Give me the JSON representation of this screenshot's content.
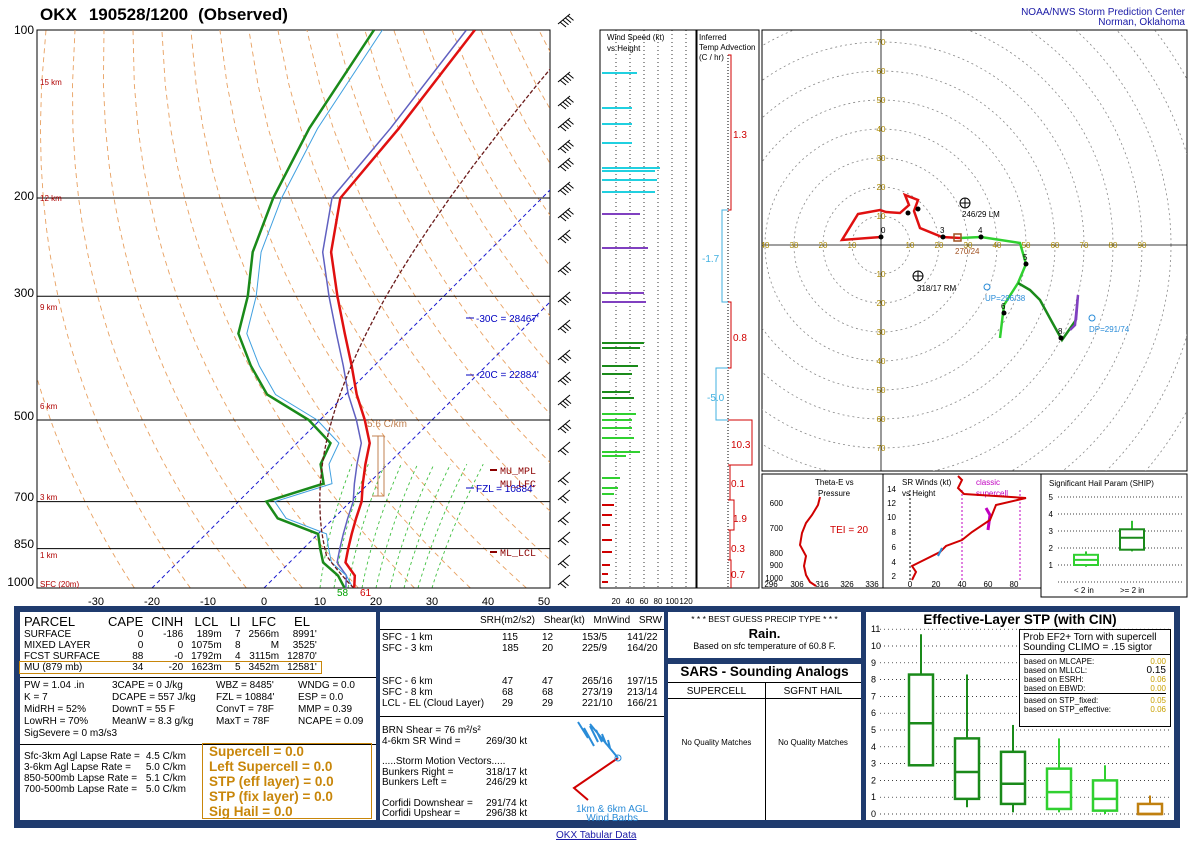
{
  "header": {
    "station": "OKX",
    "time": "190528/1200",
    "status": "(Observed)",
    "org_line1": "NOAA/NWS Storm Prediction Center",
    "org_line2": "Norman, Oklahoma"
  },
  "skewt": {
    "pressure_labels": [
      "100",
      "200",
      "300",
      "500",
      "700",
      "850",
      "1000"
    ],
    "temp_ticks": [
      "-30",
      "-20",
      "-10",
      "0",
      "10",
      "20",
      "30",
      "40",
      "50"
    ],
    "height_labels": [
      "15 km",
      "12 km",
      "9 km",
      "6 km",
      "3 km",
      "1 km",
      "SFC (20m)"
    ],
    "isotherm_labels": [
      "-30C = 28467'",
      "-20C = 22884'"
    ],
    "fzl_label": "FZL = 10884'",
    "lapse_label": "5.6 C/km",
    "mu_mpl": "MU_MPL",
    "mu_lfc": "MU_LFC",
    "ml_lcl": "ML_LCL",
    "sfc_td": "58",
    "sfc_t": "61"
  },
  "wind_speed": {
    "title1": "Wind Speed (kt)",
    "title2": "vs Height",
    "axis": [
      "20",
      "40",
      "60",
      "80",
      "100",
      "120"
    ]
  },
  "temp_adv": {
    "title1": "Inferred",
    "title2": "Temp Advection",
    "title3": "(C / hr)",
    "values": [
      "1.3",
      "-1.7",
      "0.8",
      "-5.0",
      "10.3",
      "0.1",
      "1.9",
      "0.3",
      "0.7"
    ]
  },
  "hodograph": {
    "rings": [
      "10",
      "20",
      "30",
      "40",
      "50",
      "60",
      "70"
    ],
    "lm": "246/29 LM",
    "rm": "318/17 RM",
    "mean": "270/24",
    "up": "UP=296/38",
    "dp": "DP=291/74",
    "points": [
      "0",
      "3",
      "4",
      "5",
      "6",
      "8"
    ]
  },
  "insets": {
    "theta_title1": "Theta-E vs",
    "theta_title2": "Pressure",
    "theta_axis": [
      "296",
      "306",
      "316",
      "326",
      "336"
    ],
    "theta_p": [
      "600",
      "700",
      "800",
      "900",
      "1000"
    ],
    "tei": "TEI = 20",
    "sr_title1": "SR Winds (kt)",
    "sr_title2": "vs Height",
    "sr_classic1": "classic",
    "sr_classic2": "supercell",
    "sr_heights": [
      "14",
      "12",
      "10",
      "8",
      "6",
      "4",
      "2",
      "0"
    ],
    "sr_axis": [
      "0",
      "20",
      "40",
      "60",
      "80"
    ],
    "ship_title": "Significant Hail Param (SHIP)",
    "ship_y": [
      "5",
      "4",
      "3",
      "2",
      "1"
    ],
    "ship_x1": "< 2 in",
    "ship_x2": ">= 2 in"
  },
  "parcel": {
    "headers": [
      "PARCEL",
      "CAPE",
      "CINH",
      "LCL",
      "LI",
      "LFC",
      "EL"
    ],
    "rows": [
      [
        "SURFACE",
        "0",
        "-186",
        "189m",
        "7",
        "2566m",
        "8991'"
      ],
      [
        "MIXED LAYER",
        "0",
        "0",
        "1075m",
        "8",
        "M",
        "3525'"
      ],
      [
        "FCST SURFACE",
        "88",
        "-0",
        "1792m",
        "4",
        "3115m",
        "12870'"
      ],
      [
        "MU  (879 mb)",
        "34",
        "-20",
        "1623m",
        "5",
        "3452m",
        "12581'"
      ]
    ],
    "misc_left": [
      "PW = 1.04 .in",
      "K = 7",
      "MidRH = 52%",
      "LowRH = 70%",
      "SigSevere = 0 m3/s3"
    ],
    "misc_mid1": [
      "3CAPE = 0 J/kg",
      "DCAPE = 557 J/kg",
      "DownT = 55 F",
      "MeanW = 8.3 g/kg"
    ],
    "misc_mid2": [
      "WBZ = 8485'",
      "FZL = 10884'",
      "ConvT = 78F",
      "MaxT = 78F"
    ],
    "misc_right": [
      "WNDG = 0.0",
      "ESP = 0.0",
      "MMP = 0.39",
      "NCAPE = 0.09"
    ],
    "lapse": [
      [
        "Sfc-3km Agl Lapse Rate =",
        "4.5 C/km"
      ],
      [
        "3-6km Agl Lapse Rate =",
        "5.0 C/km"
      ],
      [
        "850-500mb Lapse Rate =",
        "5.1 C/km"
      ],
      [
        "700-500mb Lapse Rate =",
        "5.0 C/km"
      ]
    ],
    "indices": [
      "Supercell = 0.0",
      "Left Supercell = 0.0",
      "STP (eff layer) = 0.0",
      "STP (fix layer) = 0.0",
      "Sig Hail = 0.0"
    ]
  },
  "kinematics": {
    "headers": [
      "SRH(m2/s2)",
      "Shear(kt)",
      "MnWind",
      "SRW"
    ],
    "rows": [
      [
        "SFC - 1 km",
        "115",
        "12",
        "153/5",
        "141/22"
      ],
      [
        "SFC - 3 km",
        "185",
        "20",
        "225/9",
        "164/20"
      ],
      [
        "",
        "",
        " ",
        "",
        ""
      ],
      [
        "SFC - 6 km",
        "47",
        "",
        "265/16",
        "197/15"
      ],
      [
        "SFC - 8 km",
        "68",
        "",
        "273/19",
        "213/14"
      ],
      [
        "LCL - EL (Cloud Layer)",
        "29",
        "",
        "221/10",
        "166/21"
      ]
    ],
    "shear_col": [
      "12",
      "20",
      "",
      "47",
      "68",
      "29"
    ],
    "brn": "BRN Shear = 76 m²/s²",
    "sr46": [
      "4-6km SR Wind =",
      "269/30 kt"
    ],
    "storm_title": ".....Storm Motion Vectors.....",
    "motions": [
      [
        "Bunkers Right =",
        "318/17 kt"
      ],
      [
        "Bunkers Left =",
        "246/29 kt"
      ],
      [
        "",
        ""
      ],
      [
        "Corfidi Downshear =",
        "291/74 kt"
      ],
      [
        "Corfidi Upshear =",
        "296/38 kt"
      ]
    ],
    "barb_label1": "1km & 6km AGL",
    "barb_label2": "Wind Barbs"
  },
  "precip": {
    "title": "* * * BEST GUESS PRECIP TYPE * * *",
    "value": "Rain.",
    "note": "Based on sfc temperature of 60.8 F."
  },
  "sars": {
    "title": "SARS - Sounding Analogs",
    "col1": "SUPERCELL",
    "col2": "SGFNT HAIL",
    "match1": "No Quality Matches",
    "match2": "No Quality Matches"
  },
  "stp": {
    "title": "Effective-Layer STP (with CIN)",
    "y_ticks": [
      "11",
      "10",
      "9",
      "8",
      "7",
      "6",
      "5",
      "4",
      "3",
      "2",
      "1",
      "0"
    ],
    "categories": [
      "EF4+",
      "EF3",
      "EF2",
      "EF1",
      "EF0",
      "NONTOR"
    ],
    "prob_title1": "Prob EF2+ Torn with supercell",
    "prob_title2": "Sounding CLIMO = .15 sigtor",
    "probs": [
      [
        "based on MLCAPE:",
        "0.00"
      ],
      [
        "based on MLLCL:",
        "0.15"
      ],
      [
        "based on ESRH:",
        "0.06"
      ],
      [
        "based on EBWD:",
        "0.00"
      ],
      [
        "based on STP_fixed:",
        "0.05"
      ],
      [
        "based on STP_effective:",
        "0.06"
      ]
    ]
  },
  "footer": {
    "link": "OKX Tabular Data"
  },
  "chart_data": [
    {
      "type": "line",
      "title": "OKX 190528/1200 (Observed)",
      "xlabel": "",
      "ylabel": "",
      "xlim": [
        -30,
        50
      ],
      "ylim": [
        1000,
        100
      ],
      "series": [
        {
          "values": [
            [
              1000,
              16.1
            ],
            [
              950,
              14
            ],
            [
              900,
              10
            ],
            [
              850,
              8
            ],
            [
              800,
              6
            ],
            [
              750,
              4
            ],
            [
              700,
              2
            ],
            [
              650,
              -1
            ],
            [
              600,
              -4
            ],
            [
              550,
              -7
            ],
            [
              500,
              -12
            ],
            [
              450,
              -18
            ],
            [
              400,
              -24
            ],
            [
              350,
              -31
            ],
            [
              300,
              -39
            ],
            [
              250,
              -48
            ],
            [
              200,
              -56
            ],
            [
              150,
              -58
            ],
            [
              100,
              -62
            ]
          ]
        },
        {
          "values": [
            [
              1000,
              14.4
            ],
            [
              950,
              11
            ],
            [
              900,
              6
            ],
            [
              850,
              3
            ],
            [
              800,
              0
            ],
            [
              750,
              -10
            ],
            [
              700,
              -15
            ],
            [
              650,
              -8
            ],
            [
              600,
              -12
            ],
            [
              550,
              -14
            ],
            [
              500,
              -22
            ],
            [
              450,
              -34
            ],
            [
              400,
              -42
            ],
            [
              350,
              -50
            ],
            [
              300,
              -55
            ],
            [
              250,
              -62
            ],
            [
              200,
              -68
            ],
            [
              150,
              -74
            ],
            [
              100,
              -80
            ]
          ]
        }
      ]
    },
    {
      "type": "box",
      "title": "Effective-Layer STP (with CIN)",
      "categories": [
        "EF4+",
        "EF3",
        "EF2",
        "EF1",
        "EF0",
        "NONTOR"
      ],
      "whisker_low": [
        2.9,
        0.4,
        0.1,
        0.1,
        0.0,
        0.0
      ],
      "q1": [
        2.9,
        0.9,
        0.6,
        0.3,
        0.2,
        0.0
      ],
      "median": [
        5.4,
        2.5,
        1.8,
        1.3,
        0.9,
        0.0
      ],
      "q3": [
        8.3,
        4.5,
        3.7,
        2.7,
        2.0,
        0.6
      ],
      "whisker_high": [
        10.7,
        8.3,
        5.3,
        4.5,
        2.9,
        1.1
      ],
      "ylim": [
        0,
        11
      ]
    },
    {
      "type": "box",
      "title": "Significant Hail Param (SHIP)",
      "categories": [
        "< 2 in",
        ">= 2 in"
      ],
      "whisker_low": [
        0.9,
        1.8
      ],
      "q1": [
        1.0,
        1.9
      ],
      "median": [
        1.3,
        2.6
      ],
      "q3": [
        1.6,
        3.1
      ],
      "whisker_high": [
        1.8,
        3.6
      ],
      "ylim": [
        0,
        5.5
      ]
    }
  ]
}
